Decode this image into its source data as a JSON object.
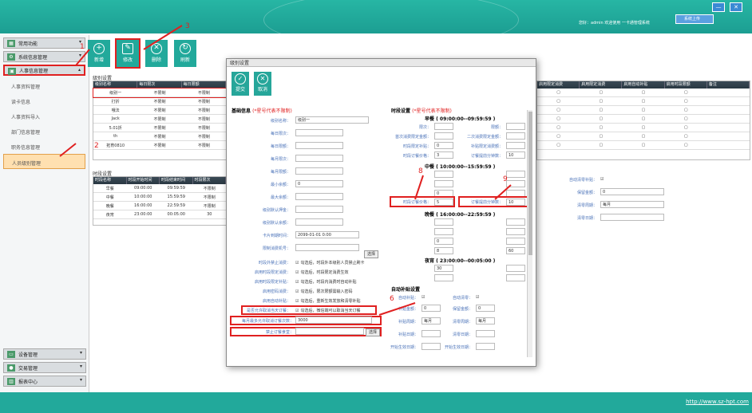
{
  "header": {
    "user": "您好：admin 欢迎使用 一卡通管理系统",
    "nav": "系统上传",
    "win_min": "—",
    "win_close": "✕"
  },
  "sidebar": {
    "items": [
      {
        "label": "常用功能",
        "icon": "grid-icon"
      },
      {
        "label": "系统信息管理",
        "icon": "gear-icon"
      },
      {
        "label": "人事信息管理",
        "icon": "id-card-icon"
      }
    ],
    "subitems": [
      "人事资料管理",
      "读卡信息",
      "人事资料导入",
      "部门信息管理",
      "职务信息管理",
      "人员级别管理"
    ],
    "bottom": [
      "设备管理",
      "交易管理",
      "报表中心"
    ]
  },
  "toolbar": [
    "新增",
    "修改",
    "删除",
    "刷新"
  ],
  "levels": {
    "title": "级别设置",
    "headers": [
      "级别名称",
      "每日限次",
      "每日限额"
    ],
    "rows": [
      [
        "级别一",
        "不限制",
        "不限制"
      ],
      [
        "打折",
        "不限制",
        "不限制"
      ],
      [
        "哦法",
        "不限制",
        "不限制"
      ],
      [
        "Jack",
        "不限制",
        "不限制"
      ],
      [
        "5.01折",
        "不限制",
        "不限制"
      ],
      [
        "th",
        "不限制",
        "不限制"
      ],
      [
        "拓育0810",
        "不限制",
        "不限制"
      ]
    ]
  },
  "periods": {
    "title": "时段设置",
    "headers": [
      "时段名称",
      "时段开始时间",
      "时段结束时间",
      "时段限次"
    ],
    "rows": [
      [
        "早餐",
        "09:00:00",
        "09:59:59",
        "不限制"
      ],
      [
        "中餐",
        "10:00:00",
        "15:59:59",
        "不限制"
      ],
      [
        "晚餐",
        "16:00:00",
        "22:59:59",
        "不限制"
      ],
      [
        "夜宵",
        "23:00:00",
        "00:05:00",
        "30"
      ]
    ]
  },
  "right_table": {
    "headers": [
      "启用限定消费",
      "启用限定消费",
      "启用自动补贴",
      "启用时段限额",
      "备注"
    ]
  },
  "right_form": {
    "auto_compensate": "自动清零补贴：",
    "keep": "保留金额：",
    "keep_val": "0",
    "cycle": "清零周期：",
    "cycle_val": "每月",
    "date": "清零日期："
  },
  "dialog": {
    "title": "级别设置",
    "submit": "提交",
    "cancel": "取消",
    "basic": "基础信息",
    "basic_note": "(*星号代表不限制)",
    "fields": [
      [
        "级别名称：",
        "级别一"
      ],
      [
        "每日限次：",
        ""
      ],
      [
        "每日限额：",
        ""
      ],
      [
        "每月限次：",
        ""
      ],
      [
        "每月限额：",
        ""
      ],
      [
        "最小余额：",
        "0"
      ],
      [
        "最大余额：",
        ""
      ],
      [
        "级别默认押金：",
        ""
      ],
      [
        "级别默认余额：",
        ""
      ],
      [
        "卡片到期时间：",
        "2099-01-01 0:00"
      ],
      [
        "限制消费机号：",
        ""
      ]
    ],
    "select": "选择",
    "checks": [
      [
        "时段外禁止消费：",
        "勾选后，时段外本级别人员禁止刷卡"
      ],
      [
        "启用时段限定消费：",
        "勾选后，时段限定消费生效"
      ],
      [
        "启用时段限定补贴：",
        "勾选后，时段内消费时自动补贴"
      ],
      [
        "启用密码消费：",
        "勾选后，限次限额需输入密码"
      ],
      [
        "启用自动补贴：",
        "勾选后，重新生效发放和清零补贴"
      ],
      [
        "是否允许取消当天订餐：",
        "勾选后，微信端可以取消当天订餐"
      ]
    ],
    "monthly_label": "每月最多允许取消订餐次数：",
    "monthly_value": "3000",
    "ban_label": "禁止订餐食堂：",
    "ban_select": "选择",
    "period": "时段设置",
    "period_note": "(*星号代表不限制)",
    "slots": [
      {
        "name": "早餐 ( 09:00:00--09:59:59 )",
        "l1": "限次：",
        "l2": "限额：",
        "l3": "首次消费限定金额：",
        "l4": "二次消费限定金额：",
        "l5": "时段限定补贴：",
        "v5": "0",
        "l6": "补贴限定消费额：",
        "l7": "时段订餐价格：",
        "v7": "3",
        "l8": "订餐提前分钟数：",
        "v8": "10"
      },
      {
        "name": "中餐 ( 10:00:00--15:59:59 )",
        "l5": "时段限定补贴：",
        "v5": "0",
        "l7": "时段订餐价格：",
        "v7": "5",
        "l8": "订餐提前分钟数：",
        "v8": "10"
      },
      {
        "name": "晚餐 ( 16:00:00--22:59:59 )",
        "v5": "0",
        "v7": "8",
        "v8": "60"
      },
      {
        "name": "夜宵 ( 23:00:00--00:05:00 )",
        "v1": "30"
      }
    ],
    "auto": "自动补贴设置",
    "auto_comp": "自动补贴：",
    "auto_clear": "自动清零：",
    "comp_amt": "补贴金额：",
    "comp_val": "0",
    "keep_amt": "保留金额：",
    "keep_val": "0",
    "comp_cycle": "补贴周期：",
    "comp_cycle_val": "每月",
    "clear_cycle": "清零周期：",
    "clear_cycle_val": "每月",
    "comp_date": "补贴日期：",
    "clear_date": "清零日期：",
    "start": "开始生效日期：",
    "start2": "开始生效日期："
  },
  "steps": [
    "1",
    "2",
    "3",
    "4",
    "5",
    "6",
    "7",
    "8",
    "9"
  ],
  "footer": {
    "link": "http://www.sz-hpt.com"
  }
}
